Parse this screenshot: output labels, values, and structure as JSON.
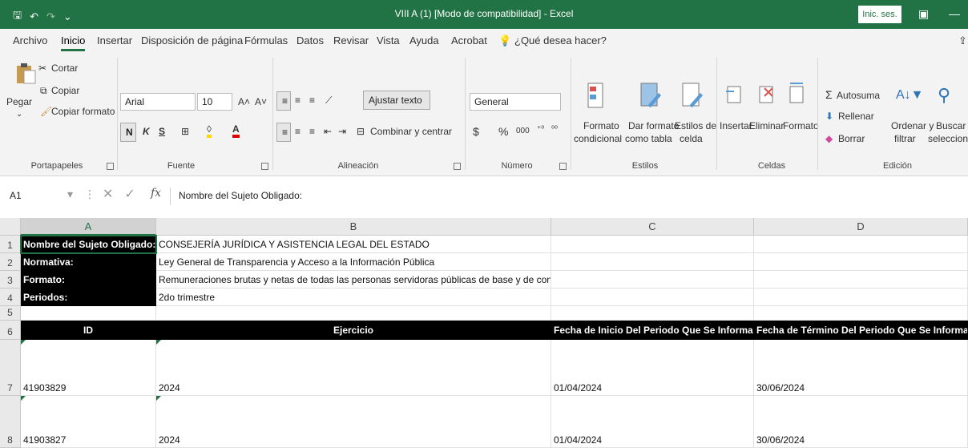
{
  "titlebar": {
    "title": "VIII A (1)  [Modo de compatibilidad]  -  Excel",
    "sign_in": "Inic. ses."
  },
  "menu": {
    "tabs": [
      "Archivo",
      "Inicio",
      "Insertar",
      "Disposición de página",
      "Fórmulas",
      "Datos",
      "Revisar",
      "Vista",
      "Ayuda",
      "Acrobat"
    ],
    "tell_me": "¿Qué desea hacer?"
  },
  "ribbon": {
    "clipboard": {
      "paste": "Pegar",
      "cut": "Cortar",
      "copy": "Copiar",
      "format_painter": "Copiar formato",
      "group": "Portapapeles"
    },
    "font": {
      "name": "Arial",
      "size": "10",
      "bold": "N",
      "italic": "K",
      "underline": "S",
      "group": "Fuente"
    },
    "alignment": {
      "wrap": "Ajustar texto",
      "merge": "Combinar y centrar",
      "group": "Alineación"
    },
    "number": {
      "format": "General",
      "currency": "$",
      "percent": "%",
      "thousands": "000",
      "group": "Número"
    },
    "styles": {
      "conditional": [
        "Formato",
        "condicional"
      ],
      "table": [
        "Dar formato",
        "como tabla"
      ],
      "cell": [
        "Estilos de",
        "celda"
      ],
      "group": "Estilos"
    },
    "cells": {
      "insert": "Insertar",
      "delete": "Eliminar",
      "format": "Formato",
      "group": "Celdas"
    },
    "editing": {
      "autosum": "Autosuma",
      "fill": "Rellenar",
      "clear": "Borrar",
      "sort": [
        "Ordenar y",
        "filtrar"
      ],
      "find": [
        "Buscar y",
        "seleccionar"
      ],
      "group": "Edición"
    }
  },
  "formula_bar": {
    "name_box": "A1",
    "content": "Nombre del Sujeto Obligado:"
  },
  "grid": {
    "columns": [
      "A",
      "B",
      "C",
      "D"
    ],
    "rows": [
      "1",
      "2",
      "3",
      "4",
      "5",
      "6",
      "7",
      "8"
    ],
    "info": [
      {
        "label": "Nombre del Sujeto Obligado:",
        "value": "CONSEJERÍA JURÍDICA Y ASISTENCIA LEGAL DEL ESTADO"
      },
      {
        "label": "Normativa:",
        "value": "Ley General de Transparencia y Acceso a la Información Pública"
      },
      {
        "label": "Formato:",
        "value": "Remuneraciones brutas y netas de todas las personas servidoras públicas de base y de confianza"
      },
      {
        "label": "Periodos:",
        "value": "2do trimestre"
      }
    ],
    "headers": [
      "ID",
      "Ejercicio",
      "Fecha de Inicio Del Periodo Que Se Informa",
      "Fecha de Término Del Periodo Que Se Informa"
    ],
    "records": [
      [
        "41903829",
        "2024",
        "01/04/2024",
        "30/06/2024"
      ],
      [
        "41903827",
        "2024",
        "01/04/2024",
        "30/06/2024"
      ]
    ]
  },
  "colors": {
    "accent": "#217346",
    "header_fill": "#000000"
  }
}
